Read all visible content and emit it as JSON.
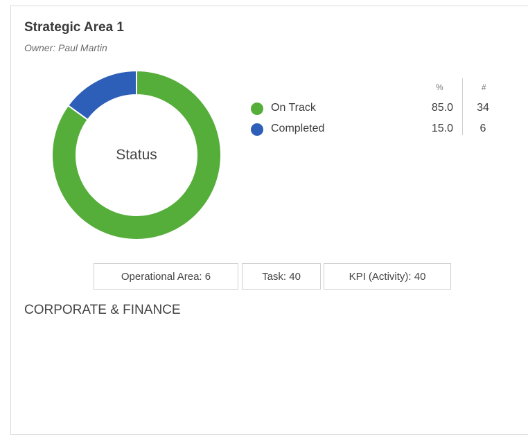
{
  "card": {
    "title": "Strategic Area 1",
    "owner": "Owner: Paul Martin"
  },
  "chart_data": {
    "type": "pie",
    "center_label": "Status",
    "columns": [
      "%",
      "#"
    ],
    "slices": [
      {
        "label": "On Track",
        "percent": "85.0",
        "count": "34",
        "value": 85.0,
        "color": "#55ad3a"
      },
      {
        "label": "Completed",
        "percent": "15.0",
        "count": "6",
        "value": 15.0,
        "color": "#2e5fb8"
      }
    ]
  },
  "summary_buttons": [
    {
      "label": "Operational Area: 6"
    },
    {
      "label": "Task: 40"
    },
    {
      "label": "KPI (Activity): 40"
    }
  ],
  "section": {
    "label": "CORPORATE & FINANCE"
  }
}
